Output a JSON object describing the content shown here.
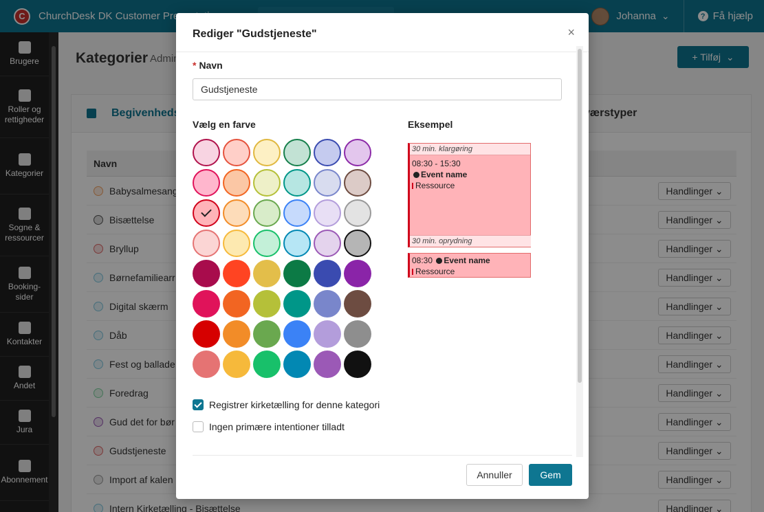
{
  "topbar": {
    "logo_letter": "C",
    "org_name": "ChurchDesk DK Customer Presentatio",
    "user_name": "Johanna",
    "user_chevron": "⌄",
    "help_label": "Få hjælp",
    "help_icon": "?"
  },
  "sidebar": {
    "items": [
      {
        "label": "Brugere",
        "icon": "user-card-icon"
      },
      {
        "label": "Roller og rettigheder",
        "icon": "key-icon"
      },
      {
        "label": "Kategorier",
        "icon": "calendar-icon"
      },
      {
        "label": "Sogne & ressourcer",
        "icon": "church-icon"
      },
      {
        "label": "Booking-sider",
        "icon": "calendar-plus-icon"
      },
      {
        "label": "Kontakter",
        "icon": "people-icon"
      },
      {
        "label": "Andet",
        "icon": "gear-icon"
      },
      {
        "label": "Jura",
        "icon": "book-icon"
      },
      {
        "label": "Abonnement",
        "icon": "credit-card-icon"
      }
    ]
  },
  "page": {
    "title": "Kategorier",
    "subtitle": "Admin",
    "add_button": "+ Tilføj",
    "add_chevron": "⌄",
    "tab_events": "Begivenheds",
    "tab_absence": "værstyper",
    "table_header_name": "Navn",
    "row_action": "Handlinger",
    "rows": [
      {
        "name": "Babysalmesang",
        "color": "#f4a261"
      },
      {
        "name": "Bisættelse",
        "color": "#555555"
      },
      {
        "name": "Bryllup",
        "color": "#e06666"
      },
      {
        "name": "Børnefamiliearr",
        "color": "#7fc8e0"
      },
      {
        "name": "Digital skærm",
        "color": "#7fc8e0"
      },
      {
        "name": "Dåb",
        "color": "#7fc8e0"
      },
      {
        "name": "Fest og ballade",
        "color": "#7fc8e0"
      },
      {
        "name": "Foredrag",
        "color": "#7fd4a0"
      },
      {
        "name": "Gud det for bør",
        "color": "#9b59b6"
      },
      {
        "name": "Gudstjeneste",
        "color": "#e06666"
      },
      {
        "name": "Import af kalen",
        "color": "#999999"
      },
      {
        "name": "Intern Kirketælling - Bisættelse",
        "color": "#7fc8e0"
      }
    ]
  },
  "modal": {
    "title": "Rediger \"Gudstjeneste\"",
    "close_symbol": "×",
    "name_label": "Navn",
    "required_mark": "*",
    "name_value": "Gudstjeneste",
    "color_label": "Vælg en farve",
    "example_label": "Eksempel",
    "selected_color_index": 12,
    "swatches": [
      {
        "fill": "#f8d4e2",
        "border": "#b0134c"
      },
      {
        "fill": "#ffcfc8",
        "border": "#e5533d"
      },
      {
        "fill": "#fdf0c4",
        "border": "#e0b840"
      },
      {
        "fill": "#c2e2d4",
        "border": "#167f4b"
      },
      {
        "fill": "#c5cbef",
        "border": "#3a4bb0"
      },
      {
        "fill": "#e3c6ed",
        "border": "#8c2ba8"
      },
      {
        "fill": "#ffb6cd",
        "border": "#e0135a"
      },
      {
        "fill": "#fbc7a5",
        "border": "#f26522"
      },
      {
        "fill": "#eef0c8",
        "border": "#b5c039"
      },
      {
        "fill": "#b6e6e2",
        "border": "#009688"
      },
      {
        "fill": "#d8dcef",
        "border": "#7986cb"
      },
      {
        "fill": "#dccbc7",
        "border": "#6d4c41"
      },
      {
        "fill": "#ffb3b8",
        "border": "#d0021b"
      },
      {
        "fill": "#fddcb9",
        "border": "#f28c28"
      },
      {
        "fill": "#d8ecc9",
        "border": "#6aa84f"
      },
      {
        "fill": "#c6dafc",
        "border": "#3b82f6"
      },
      {
        "fill": "#e8dff5",
        "border": "#b39ddb"
      },
      {
        "fill": "#e3e3e3",
        "border": "#999999"
      },
      {
        "fill": "#fbd5d4",
        "border": "#e57373"
      },
      {
        "fill": "#fde9b0",
        "border": "#f6b93b"
      },
      {
        "fill": "#c3f0d8",
        "border": "#18c06a"
      },
      {
        "fill": "#b6e6f5",
        "border": "#0288b3"
      },
      {
        "fill": "#e4d3ed",
        "border": "#9b59b6"
      },
      {
        "fill": "#b5b5b5",
        "border": "#111111"
      },
      {
        "fill": "#a80c4c",
        "solid": true
      },
      {
        "fill": "#ff4422",
        "solid": true
      },
      {
        "fill": "#e3be4a",
        "solid": true
      },
      {
        "fill": "#0c7a45",
        "solid": true
      },
      {
        "fill": "#3a4bb0",
        "solid": true
      },
      {
        "fill": "#8a24a8",
        "solid": true
      },
      {
        "fill": "#e0135a",
        "solid": true
      },
      {
        "fill": "#f26522",
        "solid": true
      },
      {
        "fill": "#b5c039",
        "solid": true
      },
      {
        "fill": "#009688",
        "solid": true
      },
      {
        "fill": "#7986cb",
        "solid": true
      },
      {
        "fill": "#6d4c41",
        "solid": true
      },
      {
        "fill": "#d60000",
        "solid": true
      },
      {
        "fill": "#f28c28",
        "solid": true
      },
      {
        "fill": "#6aa84f",
        "solid": true
      },
      {
        "fill": "#3b82f6",
        "solid": true
      },
      {
        "fill": "#b39ddb",
        "solid": true
      },
      {
        "fill": "#8e8e8e",
        "solid": true
      },
      {
        "fill": "#e57373",
        "solid": true
      },
      {
        "fill": "#f6b93b",
        "solid": true
      },
      {
        "fill": "#18c06a",
        "solid": true
      },
      {
        "fill": "#0288b3",
        "solid": true
      },
      {
        "fill": "#9b59b6",
        "solid": true
      },
      {
        "fill": "#111111",
        "solid": true
      }
    ],
    "example": {
      "prep": "30 min. klargøring",
      "time_range": "08:30  - 15:30",
      "event_name": "Event name",
      "resource": "Ressource",
      "cleanup": "30 min. oprydning",
      "short_time": "08:30"
    },
    "checkbox_church_count": {
      "label": "Registrer kirketælling for denne kategori",
      "checked": true
    },
    "checkbox_no_intentions": {
      "label": "Ingen primære intentioner tilladt",
      "checked": false
    },
    "cancel_label": "Annuller",
    "save_label": "Gem"
  }
}
